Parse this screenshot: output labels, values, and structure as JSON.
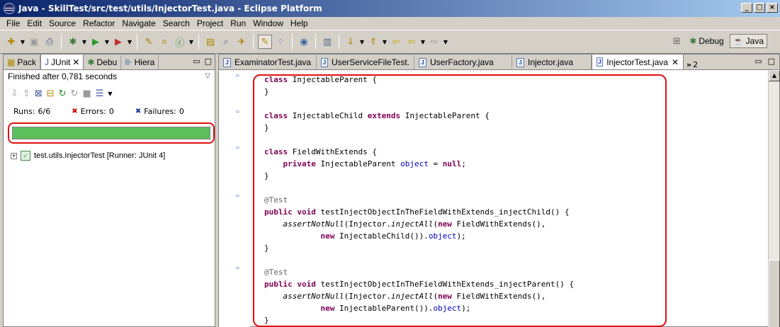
{
  "window": {
    "title": "Java - SkillTest/src/test/utils/InjectorTest.java - Eclipse Platform"
  },
  "window_controls": [
    "_",
    "□",
    "×"
  ],
  "menu": [
    "File",
    "Edit",
    "Source",
    "Refactor",
    "Navigate",
    "Search",
    "Project",
    "Run",
    "Window",
    "Help"
  ],
  "perspectives": {
    "debug": "Debug",
    "java": "Java"
  },
  "left_view": {
    "tabs": [
      "Pack",
      "JUnit",
      "Debu",
      "Hiera"
    ],
    "status": "Finished after 0,781 seconds",
    "runs_label": "Runs:",
    "runs_value": "6/6",
    "errors_label": "Errors:",
    "errors_value": "0",
    "failures_label": "Failures:",
    "failures_value": "0",
    "progress": 1.0,
    "tree_item": "test.utils.InjectorTest [Runner: JUnit 4]"
  },
  "editor": {
    "tabs": [
      "ExaminatorTest.java",
      "UserServiceFileTest.",
      "UserFactory.java",
      "Injector.java",
      "InjectorTest.java"
    ],
    "more_count": "2"
  },
  "colors": {
    "keyword": "#7f0055",
    "field": "#0000c0",
    "annotation": "#646464",
    "progress": "#5cbf5c",
    "highlight": "#e01010"
  }
}
